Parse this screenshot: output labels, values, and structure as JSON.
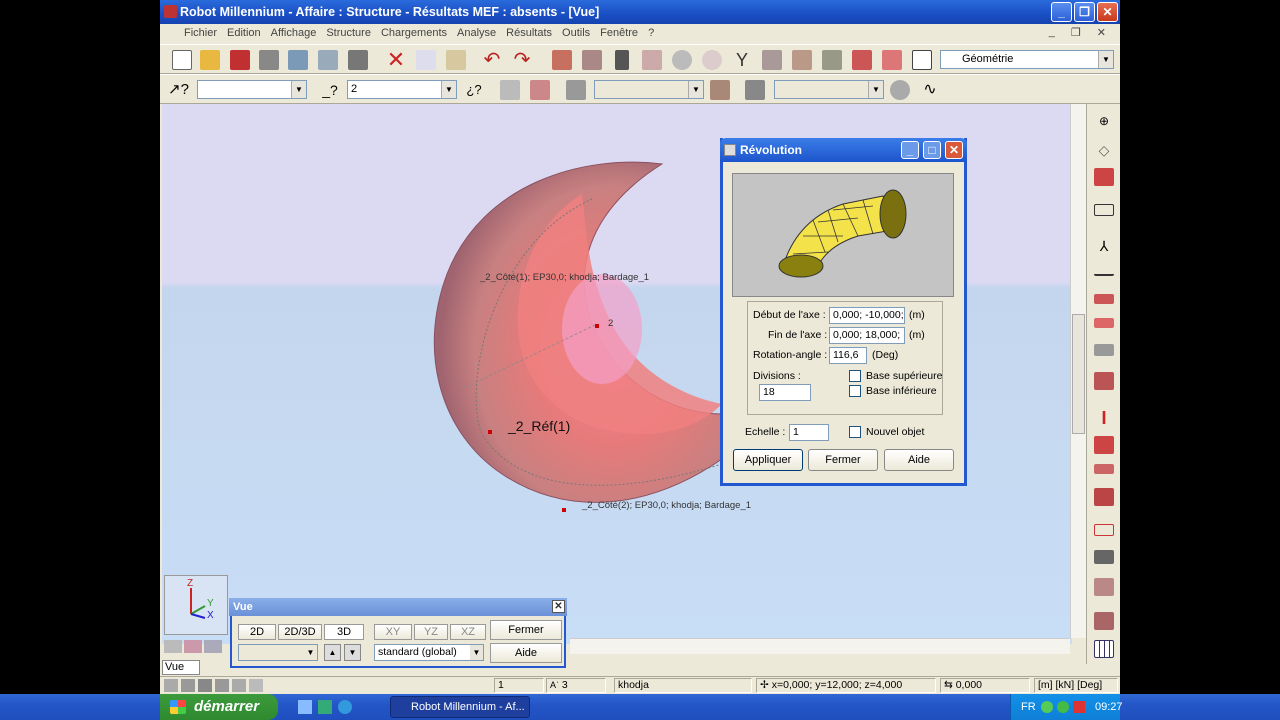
{
  "app": {
    "title": "Robot Millennium - Affaire : Structure - Résultats MEF : absents - [Vue]"
  },
  "menu": [
    "Fichier",
    "Edition",
    "Affichage",
    "Structure",
    "Chargements",
    "Analyse",
    "Résultats",
    "Outils",
    "Fenêtre",
    "?"
  ],
  "toolbar": {
    "geometry_select": "Géométrie",
    "case_select": "2"
  },
  "labels": {
    "side1": "_2_Côté(1); EP30,0; khodja; Bardage_1",
    "node2": "2",
    "ref1": "_2_Réf(1)",
    "side2": "_2_Côté(2); EP30,0; khodja; Bardage_1"
  },
  "axis": {
    "z": "Z",
    "y": "Y",
    "x": "X"
  },
  "revolution": {
    "title": "Révolution",
    "axis_start_label": "Début de l'axe :",
    "axis_start_value": "0,000; -10,000;",
    "axis_start_unit": "(m)",
    "axis_end_label": "Fin de l'axe :",
    "axis_end_value": "0,000; 18,000;",
    "axis_end_unit": "(m)",
    "angle_label": "Rotation-angle :",
    "angle_value": "116,6",
    "angle_unit": "(Deg)",
    "divisions_label": "Divisions :",
    "divisions_value": "18",
    "base_sup": "Base supérieure",
    "base_inf": "Base inférieure",
    "scale_label": "Echelle :",
    "scale_value": "1",
    "new_object": "Nouvel objet",
    "apply": "Appliquer",
    "close": "Fermer",
    "help": "Aide"
  },
  "view_panel": {
    "title": "Vue",
    "btn_2d": "2D",
    "btn_2d3d": "2D/3D",
    "btn_3d": "3D",
    "xy": "XY",
    "yz": "YZ",
    "xz": "XZ",
    "close": "Fermer",
    "help": "Aide",
    "standard": "standard (global)"
  },
  "vue_tab": "Vue",
  "status": {
    "case": "1",
    "num": "3",
    "user": "khodja",
    "coords": "x=0,000; y=12,000; z=4,000",
    "value": "0,000",
    "units": "[m] [kN] [Deg]"
  },
  "taskbar": {
    "start": "démarrer",
    "task": "Robot Millennium - Af...",
    "lang": "FR",
    "time": "09:27"
  }
}
